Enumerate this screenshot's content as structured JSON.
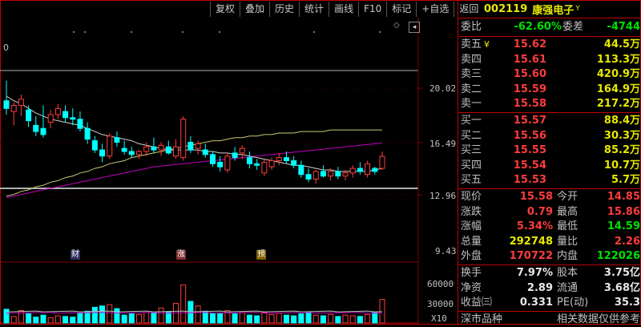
{
  "toolbar": {
    "items": [
      "复权",
      "叠加",
      "历史",
      "统计",
      "画线",
      "F10",
      "标记",
      "+自选",
      "返回"
    ]
  },
  "chart": {
    "zero_label": "0",
    "price_ticks": [
      "20.02",
      "16.49",
      "12.96",
      "9.43"
    ],
    "volume_ticks": [
      "60000",
      "30000"
    ],
    "volume_unit": "X10",
    "events": [
      "财",
      "涨",
      "预"
    ],
    "diamond": "◇",
    "scroll": "◂"
  },
  "chart_data": {
    "type": "candlestick",
    "price_axis": {
      "ticks": [
        20.02,
        16.49,
        12.96,
        9.43
      ]
    },
    "volume_axis": {
      "ticks": [
        60000,
        30000
      ],
      "unit": "X10"
    },
    "candles": [
      {
        "o": 19.2,
        "h": 20.5,
        "l": 18.3,
        "c": 18.7
      },
      {
        "o": 18.5,
        "h": 19.1,
        "l": 17.6,
        "c": 18.9
      },
      {
        "o": 18.9,
        "h": 19.6,
        "l": 18.2,
        "c": 19.3
      },
      {
        "o": 18.6,
        "h": 18.9,
        "l": 17.5,
        "c": 17.9
      },
      {
        "o": 17.6,
        "h": 18.2,
        "l": 16.9,
        "c": 17.2
      },
      {
        "o": 17.4,
        "h": 18.9,
        "l": 16.8,
        "c": 17.0
      },
      {
        "o": 17.8,
        "h": 18.6,
        "l": 17.4,
        "c": 18.3
      },
      {
        "o": 18.3,
        "h": 19.0,
        "l": 18.0,
        "c": 18.7
      },
      {
        "o": 18.5,
        "h": 18.9,
        "l": 17.8,
        "c": 18.1
      },
      {
        "o": 18.1,
        "h": 18.7,
        "l": 17.6,
        "c": 18.0
      },
      {
        "o": 18.0,
        "h": 18.5,
        "l": 17.2,
        "c": 17.4
      },
      {
        "o": 17.4,
        "h": 17.8,
        "l": 16.4,
        "c": 16.7
      },
      {
        "o": 16.6,
        "h": 16.9,
        "l": 15.8,
        "c": 16.0
      },
      {
        "o": 16.0,
        "h": 16.4,
        "l": 15.2,
        "c": 15.6
      },
      {
        "o": 15.6,
        "h": 17.1,
        "l": 15.4,
        "c": 16.9
      },
      {
        "o": 16.8,
        "h": 17.2,
        "l": 16.2,
        "c": 16.5
      },
      {
        "o": 16.1,
        "h": 16.6,
        "l": 15.7,
        "c": 15.9
      },
      {
        "o": 15.9,
        "h": 16.2,
        "l": 15.5,
        "c": 15.7
      },
      {
        "o": 15.7,
        "h": 16.0,
        "l": 15.4,
        "c": 15.9
      },
      {
        "o": 15.9,
        "h": 16.5,
        "l": 15.6,
        "c": 16.2
      },
      {
        "o": 16.2,
        "h": 16.8,
        "l": 15.8,
        "c": 16.0
      },
      {
        "o": 16.0,
        "h": 16.5,
        "l": 15.6,
        "c": 16.3
      },
      {
        "o": 16.2,
        "h": 16.6,
        "l": 15.7,
        "c": 15.8
      },
      {
        "o": 15.6,
        "h": 16.7,
        "l": 15.4,
        "c": 16.2
      },
      {
        "o": 15.5,
        "h": 18.2,
        "l": 15.3,
        "c": 18.0
      },
      {
        "o": 16.5,
        "h": 16.9,
        "l": 15.8,
        "c": 16.0
      },
      {
        "o": 16.1,
        "h": 16.6,
        "l": 15.7,
        "c": 16.4
      },
      {
        "o": 16.0,
        "h": 16.4,
        "l": 15.5,
        "c": 15.7
      },
      {
        "o": 15.7,
        "h": 15.9,
        "l": 14.9,
        "c": 15.1
      },
      {
        "o": 15.2,
        "h": 15.6,
        "l": 14.6,
        "c": 14.9
      },
      {
        "o": 14.7,
        "h": 15.8,
        "l": 14.5,
        "c": 15.6
      },
      {
        "o": 15.8,
        "h": 16.2,
        "l": 15.3,
        "c": 15.5
      },
      {
        "o": 15.8,
        "h": 16.3,
        "l": 15.4,
        "c": 16.1
      },
      {
        "o": 15.5,
        "h": 15.9,
        "l": 14.8,
        "c": 15.1
      },
      {
        "o": 15.1,
        "h": 15.4,
        "l": 14.7,
        "c": 15.0
      },
      {
        "o": 14.5,
        "h": 15.4,
        "l": 14.3,
        "c": 15.2
      },
      {
        "o": 14.9,
        "h": 15.5,
        "l": 14.7,
        "c": 15.3
      },
      {
        "o": 15.3,
        "h": 15.8,
        "l": 15.0,
        "c": 15.5
      },
      {
        "o": 15.5,
        "h": 15.9,
        "l": 15.1,
        "c": 15.3
      },
      {
        "o": 15.3,
        "h": 15.6,
        "l": 14.8,
        "c": 15.0
      },
      {
        "o": 15.0,
        "h": 15.3,
        "l": 14.2,
        "c": 14.4
      },
      {
        "o": 14.4,
        "h": 14.8,
        "l": 13.9,
        "c": 14.1
      },
      {
        "o": 14.1,
        "h": 14.7,
        "l": 13.8,
        "c": 14.6
      },
      {
        "o": 14.6,
        "h": 15.0,
        "l": 14.2,
        "c": 14.3
      },
      {
        "o": 14.3,
        "h": 14.8,
        "l": 14.0,
        "c": 14.6
      },
      {
        "o": 14.6,
        "h": 14.9,
        "l": 14.1,
        "c": 14.3
      },
      {
        "o": 14.3,
        "h": 14.7,
        "l": 14.0,
        "c": 14.5
      },
      {
        "o": 14.5,
        "h": 15.0,
        "l": 14.2,
        "c": 14.8
      },
      {
        "o": 14.8,
        "h": 15.2,
        "l": 14.4,
        "c": 14.6
      },
      {
        "o": 14.4,
        "h": 15.3,
        "l": 14.2,
        "c": 15.1
      },
      {
        "o": 14.8,
        "h": 14.9,
        "l": 14.4,
        "c": 14.6
      },
      {
        "o": 14.8,
        "h": 15.9,
        "l": 14.7,
        "c": 15.58
      }
    ],
    "ma_white": [
      19.5,
      19.2,
      19.0,
      18.7,
      18.4,
      18.2,
      18.0,
      17.9,
      17.8,
      17.7,
      17.6,
      17.4,
      17.2,
      17.0,
      16.9,
      16.8,
      16.7,
      16.6,
      16.4,
      16.3,
      16.2,
      16.1,
      16.0,
      16.0,
      16.0,
      16.0,
      16.0,
      15.9,
      15.9,
      15.8,
      15.8,
      15.7,
      15.7,
      15.6,
      15.5,
      15.4,
      15.3,
      15.2,
      15.1,
      15.0,
      15.0,
      14.9,
      14.8,
      14.7,
      14.7,
      14.6,
      14.6,
      14.6,
      14.6,
      14.6,
      14.7,
      14.8
    ],
    "ma_yellow": [
      13.0,
      13.1,
      13.3,
      13.4,
      13.6,
      13.7,
      13.9,
      14.0,
      14.2,
      14.3,
      14.5,
      14.6,
      14.8,
      14.9,
      15.1,
      15.2,
      15.3,
      15.5,
      15.6,
      15.7,
      15.8,
      15.9,
      16.0,
      16.1,
      16.2,
      16.3,
      16.4,
      16.5,
      16.6,
      16.6,
      16.7,
      16.8,
      16.8,
      16.9,
      16.9,
      17.0,
      17.0,
      17.1,
      17.1,
      17.1,
      17.2,
      17.2,
      17.2,
      17.2,
      17.3,
      17.3,
      17.3,
      17.3,
      17.3,
      17.3,
      17.3,
      17.3
    ],
    "ma_magenta": [
      12.9,
      13.0,
      13.1,
      13.2,
      13.3,
      13.4,
      13.5,
      13.6,
      13.7,
      13.8,
      13.9,
      14.0,
      14.1,
      14.2,
      14.3,
      14.4,
      14.5,
      14.6,
      14.7,
      14.8,
      14.9,
      14.95,
      15.0,
      15.05,
      15.1,
      15.15,
      15.2,
      15.25,
      15.3,
      15.35,
      15.4,
      15.45,
      15.5,
      15.55,
      15.6,
      15.65,
      15.7,
      15.75,
      15.8,
      15.85,
      15.9,
      15.95,
      16.0,
      16.05,
      16.1,
      16.15,
      16.2,
      16.25,
      16.3,
      16.35,
      16.4,
      16.45
    ],
    "volumes": [
      21000,
      10000,
      19000,
      14000,
      9000,
      12000,
      8000,
      11000,
      10000,
      9000,
      15000,
      18000,
      24000,
      26000,
      28000,
      22000,
      12000,
      14000,
      13000,
      16000,
      15000,
      23000,
      17000,
      30000,
      58000,
      33000,
      26000,
      18000,
      15000,
      14000,
      19000,
      14000,
      16000,
      12000,
      11000,
      16000,
      13000,
      15000,
      12000,
      11000,
      14000,
      17000,
      12000,
      11000,
      13000,
      10000,
      12000,
      11000,
      10000,
      13000,
      16000,
      36000
    ]
  },
  "quote": {
    "code": "002119",
    "name": "康强电子",
    "sup": "Y",
    "weibi_label": "委比",
    "weibi_value": "-62.60%",
    "weicha_label": "委差",
    "weicha_value": "-4744",
    "sell": [
      {
        "label": "卖五",
        "price": "15.62",
        "vol": "44.5万",
        "mark": "¥"
      },
      {
        "label": "卖四",
        "price": "15.61",
        "vol": "113.3万",
        "mark": ""
      },
      {
        "label": "卖三",
        "price": "15.60",
        "vol": "420.9万",
        "mark": ""
      },
      {
        "label": "卖二",
        "price": "15.59",
        "vol": "164.9万",
        "mark": ""
      },
      {
        "label": "卖一",
        "price": "15.58",
        "vol": "217.2万",
        "mark": ""
      }
    ],
    "buy": [
      {
        "label": "买一",
        "price": "15.57",
        "vol": "88.4万"
      },
      {
        "label": "买二",
        "price": "15.56",
        "vol": "30.3万"
      },
      {
        "label": "买三",
        "price": "15.55",
        "vol": "85.2万"
      },
      {
        "label": "买四",
        "price": "15.54",
        "vol": "10.7万"
      },
      {
        "label": "买五",
        "price": "15.53",
        "vol": "5.7万"
      }
    ],
    "stats": [
      {
        "l1": "现价",
        "v1": "15.58",
        "l2": "今开",
        "v2": "14.85"
      },
      {
        "l1": "涨跌",
        "v1": "0.79",
        "l2": "最高",
        "v2": "15.86"
      },
      {
        "l1": "涨幅",
        "v1": "5.34%",
        "l2": "最低",
        "v2": "14.59"
      },
      {
        "l1": "总量",
        "v1": "292748",
        "l2": "量比",
        "v2": "2.26"
      },
      {
        "l1": "外盘",
        "v1": "170722",
        "l2": "内盘",
        "v2": "122026"
      }
    ],
    "stats2": [
      {
        "l1": "换手",
        "v1": "7.97%",
        "l2": "股本",
        "v2": "3.75亿"
      },
      {
        "l1": "净资",
        "v1": "2.89",
        "l2": "流通",
        "v2": "3.68亿"
      },
      {
        "l1": "收益㈢",
        "v1": "0.331",
        "l2": "PE(动)",
        "v2": "35.3"
      }
    ],
    "footer_left": "深市品种",
    "footer_right": "相关数据仅供参考"
  },
  "colors": {
    "up": "#ff3c3c",
    "down": "#00ffff",
    "accent": "#c00000"
  }
}
